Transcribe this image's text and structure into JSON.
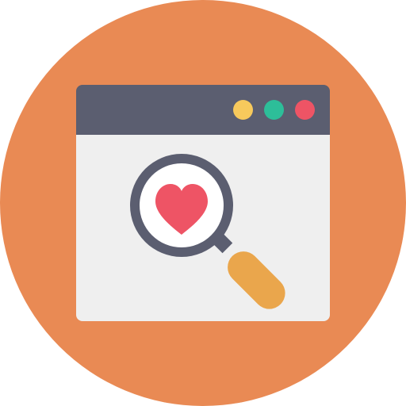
{
  "icon": {
    "name": "search-favorite-browser-icon",
    "background_color": "#E98A54",
    "window": {
      "titlebar_color": "#5B5E70",
      "content_color": "#EFEFEF",
      "control_dots": [
        {
          "name": "yellow-dot",
          "color": "#F7C95C"
        },
        {
          "name": "green-dot",
          "color": "#2DBE99"
        },
        {
          "name": "red-dot",
          "color": "#EE5465"
        }
      ]
    },
    "magnifier": {
      "rim_color": "#5B5E70",
      "lens_color": "#FFFFFF",
      "handle_color": "#EAA64C"
    },
    "heart_color": "#EE5465"
  }
}
